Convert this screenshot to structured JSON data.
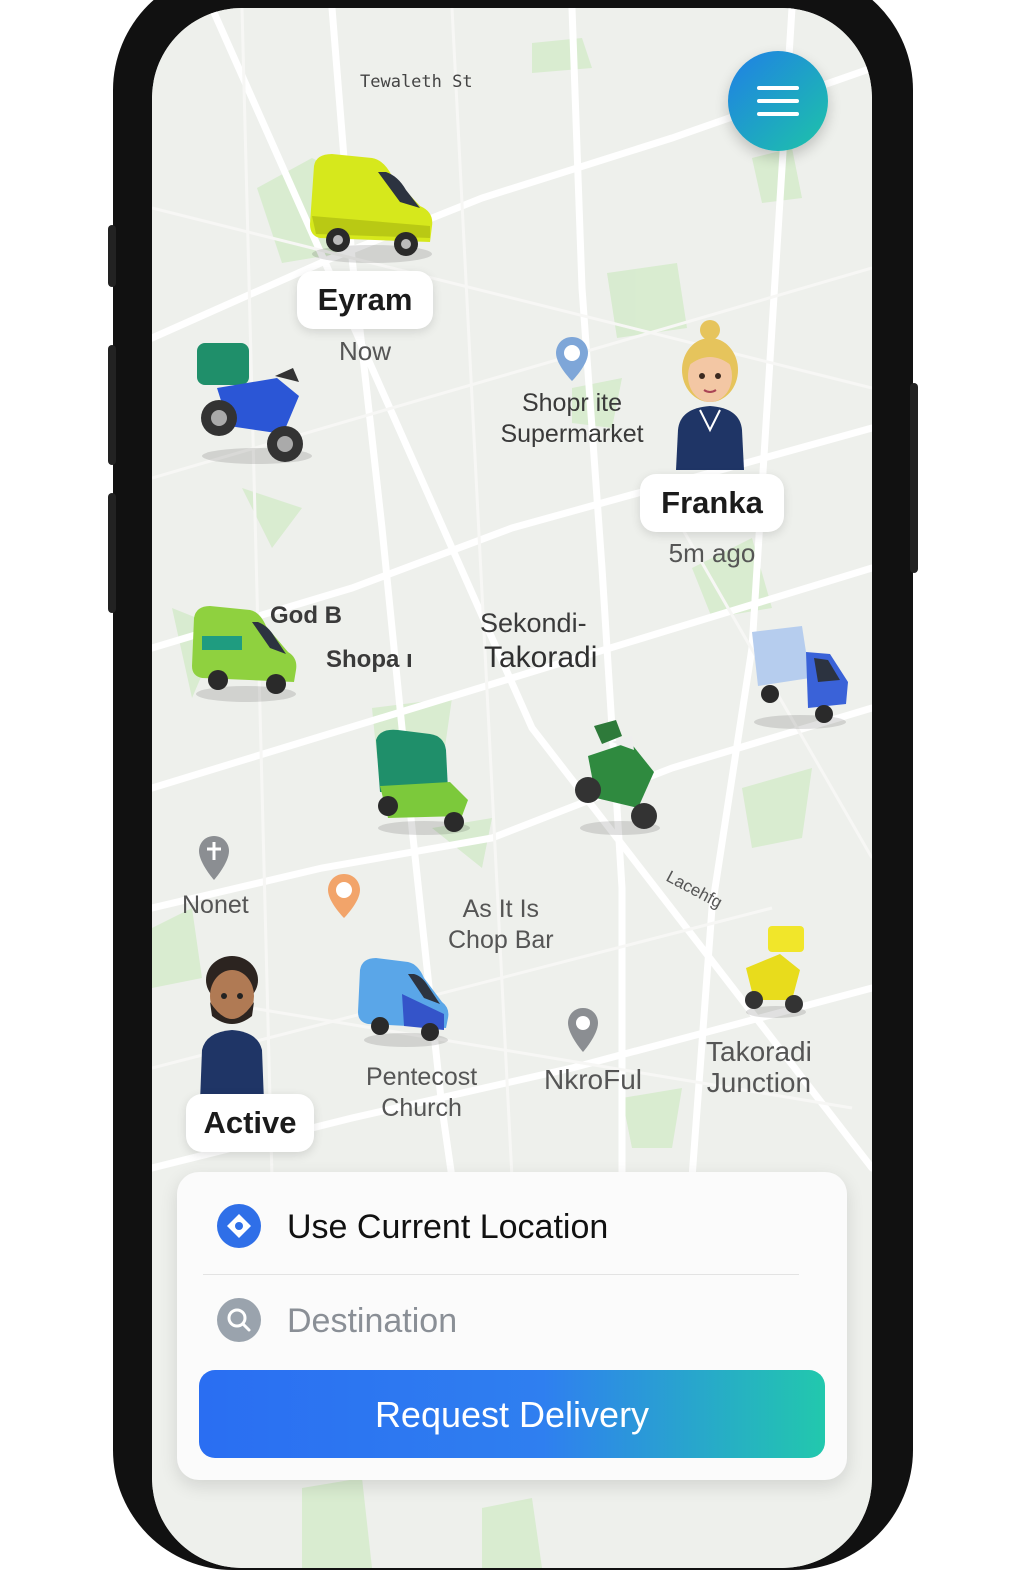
{
  "map": {
    "street_label": "Tewaleth St",
    "places": {
      "shoprite": "Shopr ite\nSupermarket",
      "god_b": "God B",
      "shopa": "Shopa ı",
      "sekondi": "Sekondi-",
      "takoradi": "Takoradi",
      "nonet": "Nonet",
      "as_it_is": "As It Is\nChop Bar",
      "pentecost": "Pentecost\nChurch",
      "nkroful": "NkroFul",
      "takoradi_junction": "Takoradi\nJunction",
      "road_label": "Lacehfg"
    }
  },
  "drivers": {
    "eyram": {
      "name": "Eyram",
      "status": "Now"
    },
    "franka": {
      "name": "Franka",
      "status": "5m ago"
    },
    "active": {
      "name": "Active"
    }
  },
  "icons": {
    "menu": "hamburger-menu-icon",
    "location": "navigation-diamond-icon",
    "search": "search-icon"
  },
  "panel": {
    "current_location": "Use Current Location",
    "destination_placeholder": "Destination",
    "request_button": "Request Delivery"
  },
  "colors": {
    "accent_blue": "#2a6ef2",
    "accent_teal": "#22c8ad"
  }
}
